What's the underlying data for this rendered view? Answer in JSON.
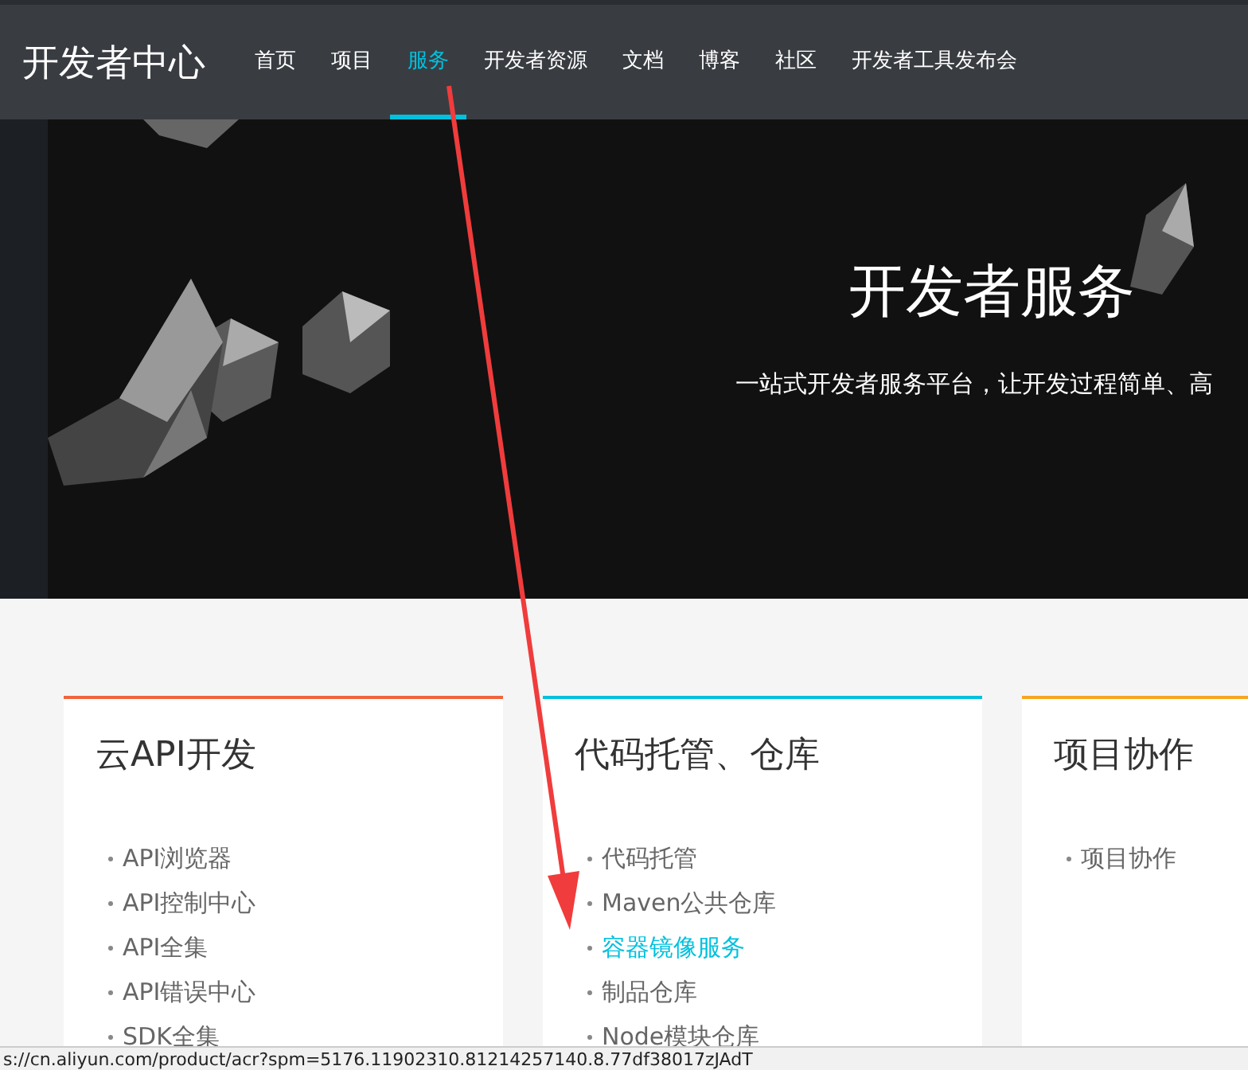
{
  "header": {
    "logo": "开发者中心",
    "nav": [
      {
        "label": "首页",
        "selected": false
      },
      {
        "label": "项目",
        "selected": false
      },
      {
        "label": "服务",
        "selected": true
      },
      {
        "label": "开发者资源",
        "selected": false
      },
      {
        "label": "文档",
        "selected": false
      },
      {
        "label": "博客",
        "selected": false
      },
      {
        "label": "社区",
        "selected": false
      },
      {
        "label": "开发者工具发布会",
        "selected": false
      }
    ]
  },
  "hero": {
    "title": "开发者服务",
    "subtitle": "一站式开发者服务平台，让开发过程简单、高"
  },
  "cards": [
    {
      "title": "云API开发",
      "color": "#f0643c",
      "items": [
        {
          "label": "API浏览器",
          "selected": false
        },
        {
          "label": "API控制中心",
          "selected": false
        },
        {
          "label": "API全集",
          "selected": false
        },
        {
          "label": "API错误中心",
          "selected": false
        },
        {
          "label": "SDK全集",
          "selected": false
        }
      ]
    },
    {
      "title": "代码托管、仓库",
      "color": "#00c1de",
      "items": [
        {
          "label": "代码托管",
          "selected": false
        },
        {
          "label": "Maven公共仓库",
          "selected": false
        },
        {
          "label": "容器镜像服务",
          "selected": true
        },
        {
          "label": "制品仓库",
          "selected": false
        },
        {
          "label": "Node模块仓库",
          "selected": false
        }
      ]
    },
    {
      "title": "项目协作",
      "color": "#f5a623",
      "items": [
        {
          "label": "项目协作",
          "selected": false
        }
      ]
    }
  ],
  "status_bar": {
    "url": "s://cn.aliyun.com/product/acr?spm=5176.11902310.81214257140.8.77df38017zJAdT"
  }
}
